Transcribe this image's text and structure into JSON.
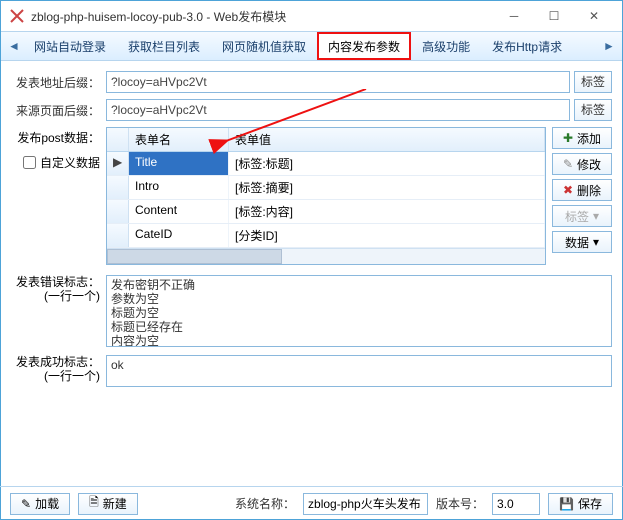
{
  "window": {
    "title": "zblog-php-huisem-locoy-pub-3.0 - Web发布模块"
  },
  "tabs": {
    "items": [
      "网站自动登录",
      "获取栏目列表",
      "网页随机值获取",
      "内容发布参数",
      "高级功能",
      "发布Http请求"
    ],
    "active": 3,
    "highlight": 3
  },
  "form": {
    "addr_suffix_label": "发表地址后缀：",
    "addr_suffix_value": "?locoy=aHVpc2Vt",
    "ref_suffix_label": "来源页面后缀：",
    "ref_suffix_value": "?locoy=aHVpc2Vt",
    "post_data_label": "发布post数据：",
    "custom_data_label": "自定义数据",
    "tag_btn": "标签",
    "data_btn": "数据"
  },
  "grid": {
    "headers": [
      "",
      "表单名",
      "表单值"
    ],
    "rows": [
      {
        "sel": true,
        "name": "Title",
        "value": "[标签:标题]"
      },
      {
        "name": "Intro",
        "value": "[标签:摘要]"
      },
      {
        "name": "Content",
        "value": "[标签:内容]"
      },
      {
        "name": "CateID",
        "value": "[分类ID]"
      }
    ]
  },
  "sidebtns": {
    "add": "添加",
    "edit": "修改",
    "del": "删除",
    "tag": "标签",
    "data": "数据"
  },
  "error_flag": {
    "label": "发表错误标志：",
    "sub": "(一行一个)",
    "value": "发布密钥不正确\n参数为空\n标题为空\n标题已经存在\n内容为空"
  },
  "success_flag": {
    "label": "发表成功标志：",
    "sub": "(一行一个)",
    "value": "ok"
  },
  "footer": {
    "load": "加载",
    "new": "新建",
    "sysname_label": "系统名称：",
    "sysname": "zblog-php火车头发布",
    "ver_label": "版本号：",
    "ver": "3.0",
    "save": "保存"
  }
}
